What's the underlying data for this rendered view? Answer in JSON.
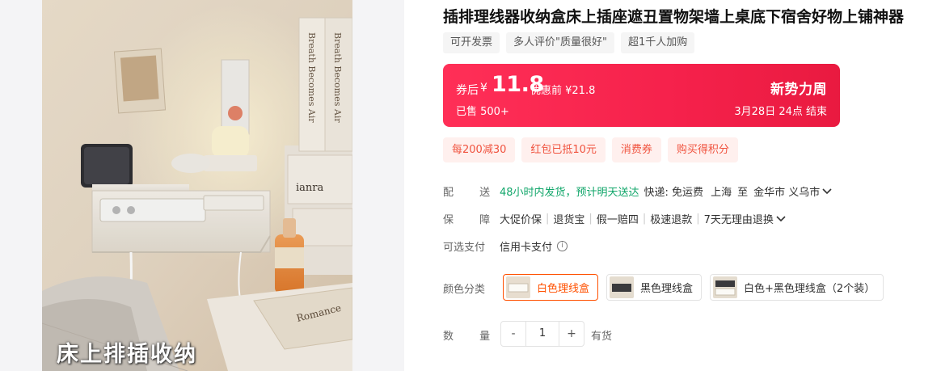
{
  "product": {
    "title": "插排理线器收纳盒床上插座遮丑置物架墙上桌底下宿舍好物上铺神器",
    "image_caption": "床上排插收纳",
    "image_box_text": "ianra"
  },
  "tags": [
    "可开发票",
    "多人评价\"质量很好\"",
    "超1千人加购"
  ],
  "price": {
    "after_label": "券后",
    "yen": "¥",
    "value": "11.8",
    "before": "优惠前 ¥21.8",
    "sold": "已售 500+",
    "promo": "新势力周",
    "end": "3月28日 24点 结束"
  },
  "coupons": [
    "每200减30",
    "红包已抵10元",
    "消费券",
    "购买得积分"
  ],
  "shipping": {
    "label": "配 送",
    "fast": "48小时内发货，预计明天送达",
    "express": "快递: 免运费",
    "from": "上海",
    "to_word": "至",
    "to": "金华市 义乌市"
  },
  "guarantee": {
    "label": "保 障",
    "items": [
      "大促价保",
      "退货宝",
      "假一赔四",
      "极速退款",
      "7天无理由退换"
    ]
  },
  "payment": {
    "label": "可选支付",
    "value": "信用卡支付",
    "info_icon": "i"
  },
  "color": {
    "label": "颜色分类",
    "options": [
      "白色理线盒",
      "黑色理线盒",
      "白色+黑色理线盒（2个装）"
    ],
    "selected": 0
  },
  "quantity": {
    "label": "数 量",
    "minus": "-",
    "value": "1",
    "plus": "+",
    "stock": "有货"
  },
  "colors": {
    "price_red": "#f5214b",
    "green": "#11a66a",
    "coupon_text": "#f0533f",
    "selected_border": "#ff5000"
  }
}
